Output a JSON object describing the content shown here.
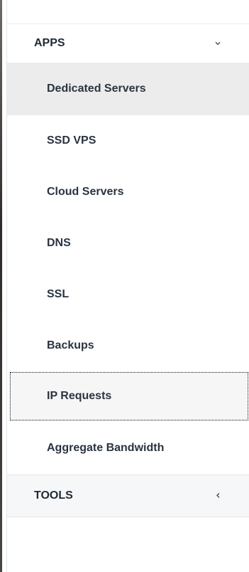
{
  "menu": {
    "apps": {
      "label": "APPS",
      "chevron": "chevron-down-icon",
      "items": [
        {
          "label": "Dedicated Servers",
          "state": "active"
        },
        {
          "label": "SSD VPS"
        },
        {
          "label": "Cloud Servers"
        },
        {
          "label": "DNS"
        },
        {
          "label": "SSL"
        },
        {
          "label": "Backups"
        },
        {
          "label": "IP Requests",
          "state": "focused"
        },
        {
          "label": "Aggregate Bandwidth"
        }
      ]
    },
    "tools": {
      "label": "TOOLS",
      "chevron": "chevron-left-icon"
    }
  },
  "colors": {
    "text": "#1f2a36",
    "active_bg": "#ececec",
    "section_bg": "#f6f7f8",
    "divider": "#e4e4e4"
  }
}
